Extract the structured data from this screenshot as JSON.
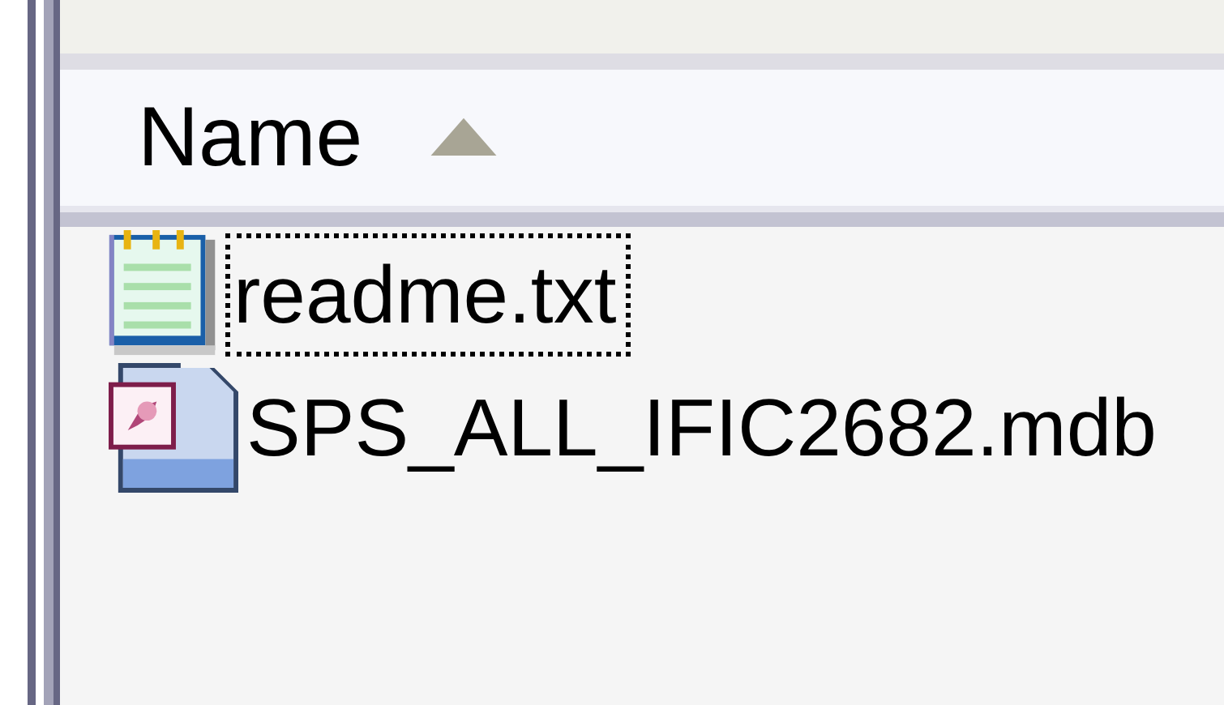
{
  "column_header": {
    "label": "Name",
    "sort_ascending": true
  },
  "files": [
    {
      "name": "readme.txt",
      "kind": "text",
      "focused": true
    },
    {
      "name": "SPS_ALL_IFIC2682.mdb",
      "kind": "database",
      "focused": false
    }
  ]
}
